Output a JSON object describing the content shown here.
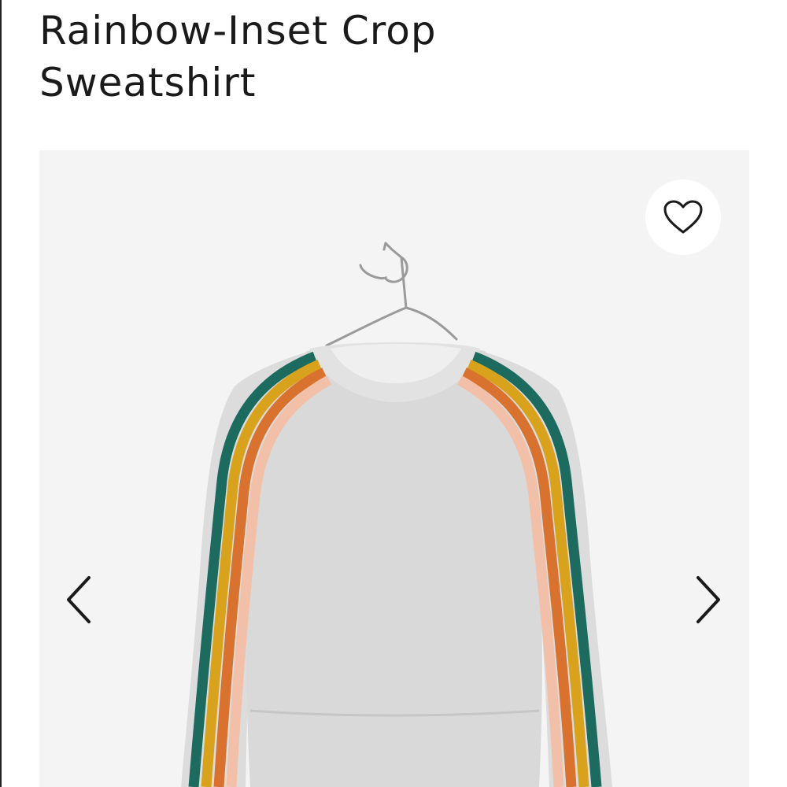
{
  "product": {
    "title_line1": "Rainbow-Inset Crop",
    "title_line2": "Sweatshirt"
  },
  "gallery": {
    "favorite_icon": "heart-outline-icon",
    "prev_icon": "chevron-left-icon",
    "next_icon": "chevron-right-icon",
    "image_subject": "gray sweatshirt with rainbow sleeve stripes on hanger"
  },
  "colors": {
    "background": "#ffffff",
    "gallery_background": "#f4f4f4",
    "sweatshirt": "#dcdcdc",
    "stripe_teal": "#1d6b5e",
    "stripe_mustard": "#d9a21c",
    "stripe_orange": "#d9722e",
    "stripe_peach": "#f2c0a8"
  }
}
